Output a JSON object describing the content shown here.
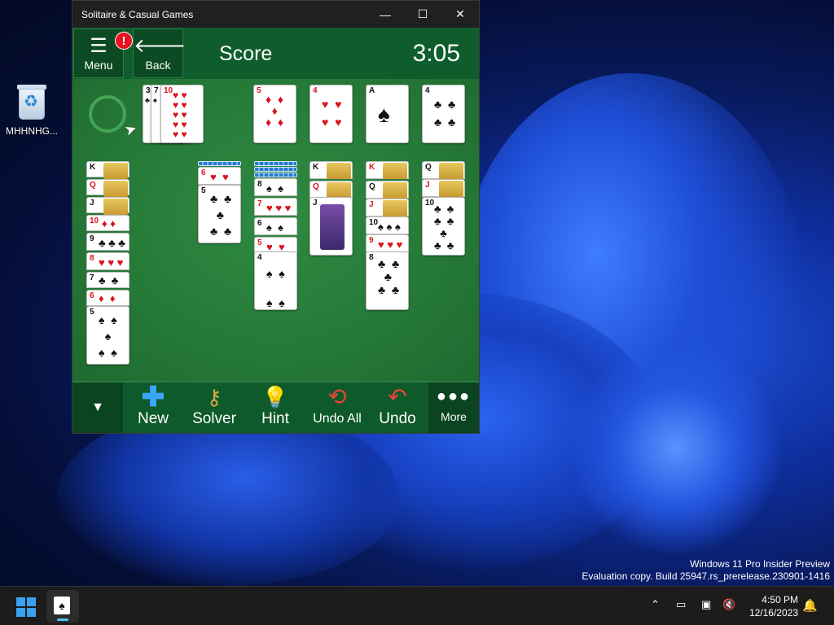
{
  "desktop": {
    "recycle_bin_label": "MHHNHG...",
    "watermark_line1": "Windows 11 Pro Insider Preview",
    "watermark_line2": "Evaluation copy. Build 25947.rs_prerelease.230901-1416"
  },
  "window": {
    "title": "Solitaire & Casual Games",
    "minimize": "—",
    "maximize": "☐",
    "close": "✕"
  },
  "topbar": {
    "menu_label": "Menu",
    "menu_alert": "!",
    "back_label": "Back",
    "score_label": "Score",
    "timer": "3:05"
  },
  "bottombar": {
    "new_label": "New",
    "solver_label": "Solver",
    "hint_label": "Hint",
    "undo_all_label": "Undo All",
    "undo_label": "Undo",
    "more_label": "More"
  },
  "taskbar": {
    "time": "4:50 PM",
    "date": "12/16/2023"
  },
  "cards": {
    "waste_1": "3",
    "waste_2": "7",
    "waste_3": "10",
    "found_1": "5",
    "found_2": "4",
    "found_3": "A",
    "found_4": "4",
    "t1_1": "K",
    "t1_2": "Q",
    "t1_3": "J",
    "t1_4": "10",
    "t1_5": "9",
    "t1_6": "8",
    "t1_7": "7",
    "t1_8": "6",
    "t1_9": "5",
    "t3_1": "6",
    "t3_2": "5",
    "t4_1": "8",
    "t4_2": "7",
    "t4_3": "6",
    "t4_4": "5",
    "t4_5": "4",
    "t5_1": "K",
    "t5_2": "Q",
    "t5_3": "J",
    "t6_1": "K",
    "t6_2": "Q",
    "t6_3": "J",
    "t6_4": "10",
    "t6_5": "9",
    "t6_6": "8",
    "t7_1": "Q",
    "t7_2": "J",
    "t7_3": "10"
  },
  "colors": {
    "felt": "#267a38",
    "bar": "#0f5d2c",
    "alert": "#e81123",
    "accent": "#4cc2ff"
  }
}
